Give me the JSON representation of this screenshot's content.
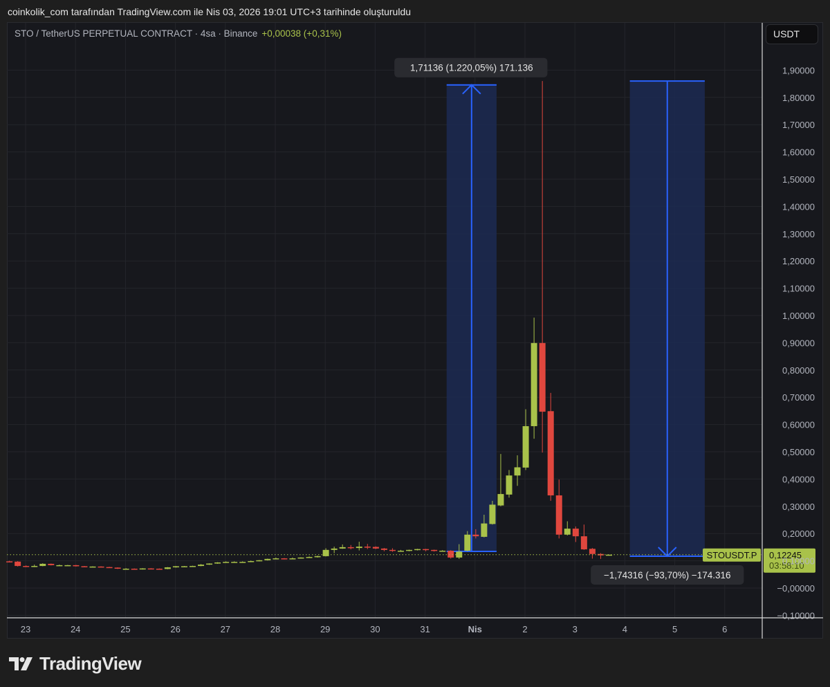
{
  "credit": "coinkolik_com tarafından TradingView.com ile Nis 03, 2026 19:01 UTC+3 tarihinde oluşturuldu",
  "legend": {
    "symbol": "STO / TetherUS PERPETUAL CONTRACT · 4sa · Binance",
    "change": "+0,00038 (+0,31%)"
  },
  "unit_button": "USDT",
  "brand": "TradingView",
  "colors": {
    "up": "#a9c24a",
    "down": "#e0473e",
    "measure": "#2962ff",
    "measure_fill": "#1c2a52"
  },
  "chart_data": {
    "type": "candlestick",
    "title": "STO / TetherUS PERPETUAL CONTRACT · 4sa · Binance",
    "ylim": [
      -0.1,
      1.95
    ],
    "y_ticks": [
      1.9,
      1.8,
      1.7,
      1.6,
      1.5,
      1.4,
      1.3,
      1.2,
      1.1,
      1.0,
      0.9,
      0.8,
      0.7,
      0.6,
      0.5,
      0.4,
      0.3,
      0.2,
      0.1,
      0.0,
      -0.1
    ],
    "y_tick_labels": [
      "1,90000",
      "1,80000",
      "1,70000",
      "1,60000",
      "1,50000",
      "1,40000",
      "1,30000",
      "1,20000",
      "1,10000",
      "1,00000",
      "0,90000",
      "0,80000",
      "0,70000",
      "0,60000",
      "0,50000",
      "0,40000",
      "0,30000",
      "0,20000",
      "0,10000",
      "−0,00000",
      "−0,10000"
    ],
    "x_tick_labels": [
      "23",
      "24",
      "25",
      "26",
      "27",
      "28",
      "29",
      "30",
      "31",
      "Nis",
      "2",
      "3",
      "4",
      "5",
      "6"
    ],
    "grid": true,
    "candles": [
      [
        0.098,
        0.1,
        0.096,
        0.097
      ],
      [
        0.097,
        0.099,
        0.079,
        0.081
      ],
      [
        0.081,
        0.083,
        0.077,
        0.079
      ],
      [
        0.079,
        0.086,
        0.077,
        0.081
      ],
      [
        0.081,
        0.091,
        0.08,
        0.089
      ],
      [
        0.089,
        0.09,
        0.083,
        0.084
      ],
      [
        0.084,
        0.086,
        0.083,
        0.084
      ],
      [
        0.084,
        0.085,
        0.082,
        0.084
      ],
      [
        0.084,
        0.085,
        0.079,
        0.08
      ],
      [
        0.08,
        0.081,
        0.078,
        0.079
      ],
      [
        0.079,
        0.08,
        0.077,
        0.079
      ],
      [
        0.079,
        0.08,
        0.076,
        0.077
      ],
      [
        0.077,
        0.078,
        0.074,
        0.075
      ],
      [
        0.075,
        0.076,
        0.07,
        0.071
      ],
      [
        0.071,
        0.073,
        0.07,
        0.071
      ],
      [
        0.071,
        0.072,
        0.068,
        0.069
      ],
      [
        0.069,
        0.073,
        0.068,
        0.072
      ],
      [
        0.072,
        0.073,
        0.07,
        0.071
      ],
      [
        0.071,
        0.072,
        0.069,
        0.07
      ],
      [
        0.07,
        0.077,
        0.069,
        0.076
      ],
      [
        0.076,
        0.081,
        0.075,
        0.08
      ],
      [
        0.08,
        0.081,
        0.079,
        0.08
      ],
      [
        0.08,
        0.082,
        0.079,
        0.081
      ],
      [
        0.081,
        0.088,
        0.08,
        0.086
      ],
      [
        0.086,
        0.091,
        0.085,
        0.09
      ],
      [
        0.09,
        0.095,
        0.089,
        0.094
      ],
      [
        0.094,
        0.098,
        0.093,
        0.096
      ],
      [
        0.096,
        0.098,
        0.095,
        0.096
      ],
      [
        0.096,
        0.098,
        0.095,
        0.096
      ],
      [
        0.096,
        0.101,
        0.095,
        0.099
      ],
      [
        0.099,
        0.103,
        0.098,
        0.102
      ],
      [
        0.102,
        0.108,
        0.101,
        0.107
      ],
      [
        0.107,
        0.112,
        0.106,
        0.109
      ],
      [
        0.109,
        0.11,
        0.105,
        0.107
      ],
      [
        0.107,
        0.112,
        0.106,
        0.109
      ],
      [
        0.109,
        0.113,
        0.108,
        0.112
      ],
      [
        0.112,
        0.116,
        0.111,
        0.114
      ],
      [
        0.114,
        0.119,
        0.112,
        0.117
      ],
      [
        0.117,
        0.146,
        0.116,
        0.14
      ],
      [
        0.14,
        0.152,
        0.128,
        0.145
      ],
      [
        0.145,
        0.16,
        0.144,
        0.15
      ],
      [
        0.15,
        0.158,
        0.142,
        0.147
      ],
      [
        0.147,
        0.17,
        0.138,
        0.152
      ],
      [
        0.152,
        0.162,
        0.143,
        0.151
      ],
      [
        0.151,
        0.153,
        0.143,
        0.145
      ],
      [
        0.145,
        0.147,
        0.135,
        0.14
      ],
      [
        0.14,
        0.146,
        0.133,
        0.137
      ],
      [
        0.137,
        0.14,
        0.133,
        0.137
      ],
      [
        0.137,
        0.141,
        0.135,
        0.14
      ],
      [
        0.14,
        0.144,
        0.138,
        0.143
      ],
      [
        0.143,
        0.144,
        0.135,
        0.14
      ],
      [
        0.14,
        0.141,
        0.134,
        0.136
      ],
      [
        0.136,
        0.139,
        0.134,
        0.137
      ],
      [
        0.137,
        0.139,
        0.108,
        0.112
      ],
      [
        0.112,
        0.161,
        0.107,
        0.134
      ],
      [
        0.137,
        0.209,
        0.135,
        0.196
      ],
      [
        0.196,
        0.216,
        0.182,
        0.19
      ],
      [
        0.188,
        0.269,
        0.186,
        0.237
      ],
      [
        0.235,
        0.32,
        0.233,
        0.306
      ],
      [
        0.303,
        0.492,
        0.3,
        0.345
      ],
      [
        0.343,
        0.433,
        0.332,
        0.413
      ],
      [
        0.413,
        0.487,
        0.375,
        0.443
      ],
      [
        0.442,
        0.656,
        0.433,
        0.594
      ],
      [
        0.594,
        0.992,
        0.548,
        0.899
      ],
      [
        0.899,
        1.86,
        0.497,
        0.647
      ],
      [
        0.649,
        0.716,
        0.32,
        0.34
      ],
      [
        0.34,
        0.398,
        0.182,
        0.196
      ],
      [
        0.196,
        0.245,
        0.193,
        0.218
      ],
      [
        0.218,
        0.226,
        0.169,
        0.19
      ],
      [
        0.19,
        0.233,
        0.14,
        0.142
      ],
      [
        0.144,
        0.147,
        0.108,
        0.125
      ],
      [
        0.125,
        0.128,
        0.107,
        0.12
      ],
      [
        0.1207,
        0.123,
        0.1205,
        0.12245
      ]
    ],
    "last_price": {
      "symbol": "STOUSDT.P",
      "value": 0.12245,
      "value_label": "0,12245",
      "countdown": "03:58:10"
    },
    "measures": [
      {
        "from_price": 0.1345,
        "to_price": 1.8459,
        "from_bar": 53,
        "to_bar": 58,
        "label": "1,71136 (1.220,05%) 171.136"
      },
      {
        "from_price": 1.86,
        "to_price": 0.1168,
        "from_bar": 75,
        "to_bar": 83,
        "label": "−1,74316 (−93,70%) −174.316"
      }
    ]
  }
}
